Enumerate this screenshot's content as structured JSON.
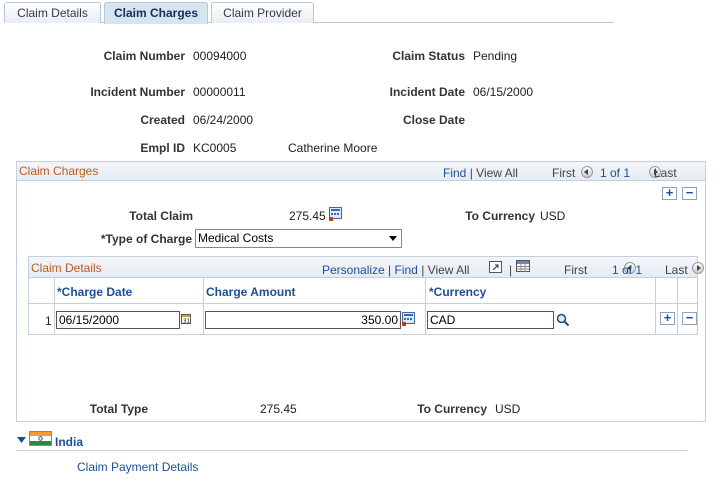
{
  "tabs": [
    {
      "label": "Claim Details"
    },
    {
      "label": "Claim Charges"
    },
    {
      "label": "Claim Provider"
    }
  ],
  "header": {
    "claim_number_label": "Claim Number",
    "claim_number": "00094000",
    "claim_status_label": "Claim Status",
    "claim_status": "Pending",
    "incident_number_label": "Incident Number",
    "incident_number": "00000011",
    "incident_date_label": "Incident Date",
    "incident_date": "06/15/2000",
    "created_label": "Created",
    "created": "06/24/2000",
    "close_date_label": "Close Date",
    "empl_id_label": "Empl ID",
    "empl_id": "KC0005",
    "employee_name": "Catherine Moore"
  },
  "charges": {
    "title": "Claim Charges",
    "nav": {
      "find": "Find",
      "sep": "|",
      "view_all": "View All",
      "first": "First",
      "count": "1 of 1",
      "last": "Last"
    },
    "total_claim_label": "Total Claim",
    "total_claim": "275.45",
    "to_currency_label": "To Currency",
    "to_currency": "USD",
    "type_of_charge_label": "*Type of Charge",
    "type_of_charge": "Medical Costs",
    "details": {
      "title": "Claim Details",
      "nav": {
        "personalize": "Personalize",
        "sep": "|",
        "find": "Find",
        "view_all": "View All",
        "first": "First",
        "count": "1 of 1",
        "last": "Last"
      },
      "columns": [
        "*Charge Date",
        "Charge Amount",
        "*Currency"
      ],
      "rows": [
        {
          "num": "1",
          "charge_date": "06/15/2000",
          "charge_amount": "350.00",
          "currency": "CAD"
        }
      ]
    },
    "total_type_label": "Total Type",
    "total_type": "275.45",
    "to_currency2_label": "To Currency",
    "to_currency2": "USD"
  },
  "india": {
    "label": "India",
    "link": "Claim Payment Details"
  },
  "colors": {
    "accent": "#1e4f96",
    "panel_title": "#bb5a1c",
    "border": "#c4cfd9"
  }
}
